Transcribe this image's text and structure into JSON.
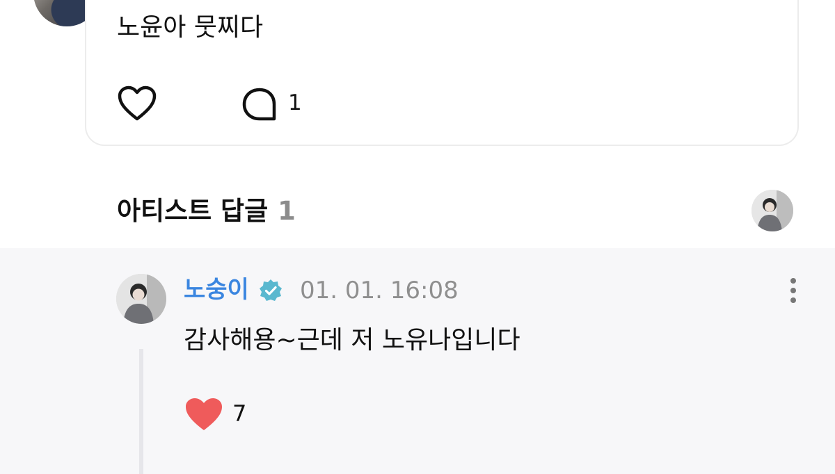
{
  "post": {
    "text": "노윤아 뭇찌다",
    "comment_count": "1",
    "icons": {
      "like": "heart-outline-icon",
      "comment": "speech-bubble-icon"
    }
  },
  "artist_replies": {
    "title": "아티스트 답글",
    "count": "1"
  },
  "reply": {
    "author": "노숭이",
    "time": "01. 01. 16:08",
    "text": "감사해용~근데 저 노유나입니다",
    "like_count": "7",
    "colors": {
      "author": "#3b86e0",
      "verified": "#5ab8cf",
      "heart": "#ef5b5b"
    },
    "icons": {
      "verified": "verified-badge-icon",
      "more": "more-vertical-icon",
      "like": "heart-filled-icon"
    }
  }
}
